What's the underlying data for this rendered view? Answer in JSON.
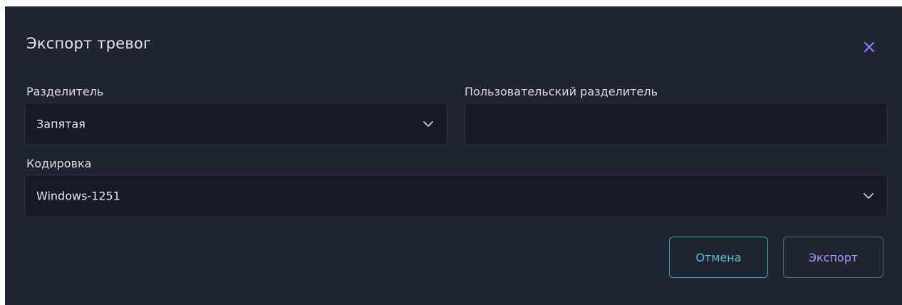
{
  "dialog": {
    "title": "Экспорт тревог",
    "close_icon": "close-icon",
    "accent_color": "#8a7cf0"
  },
  "separator": {
    "label": "Разделитель",
    "value": "Запятая",
    "icon": "chevron-down-icon"
  },
  "custom_separator": {
    "label": "Пользовательский разделитель",
    "value": "",
    "placeholder": ""
  },
  "encoding": {
    "label": "Кодировка",
    "value": "Windows-1251",
    "icon": "chevron-down-icon"
  },
  "buttons": {
    "cancel_label": "Отмена",
    "export_label": "Экспорт",
    "cancel_color": "#58b7d4",
    "export_color": "#a792ee"
  }
}
